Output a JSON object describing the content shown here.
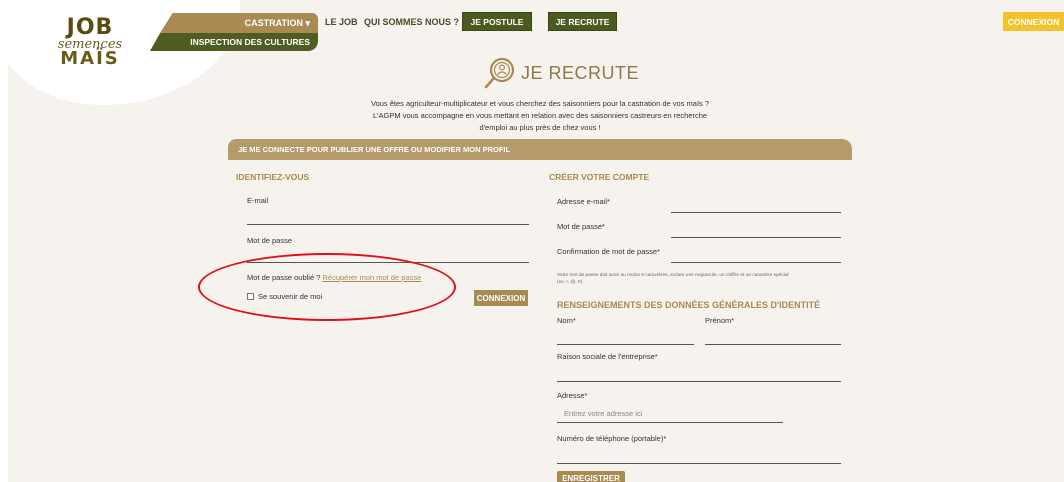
{
  "brand": {
    "line1": "JOB",
    "line2": "semences",
    "line3": "MAÏS"
  },
  "nav": {
    "castration": "CASTRATION ▾",
    "inspection": "INSPECTION DES CULTURES",
    "le_job": "LE JOB",
    "qui_sommes_nous": "QUI SOMMES NOUS ?",
    "je_postule": "JE POSTULE",
    "je_recrute": "JE RECRUTE",
    "connexion": "CONNEXION"
  },
  "page": {
    "title": "JE RECRUTE",
    "intro_l1": "Vous êtes agriculteur-multiplicateur et vous cherchez des saisonniers pour la castration de vos maïs ?",
    "intro_l2": "L'AGPM vous accompagne en vous mettant en relation avec des saisonniers castreurs en recherche",
    "intro_l3": "d'emploi au plus près de chez vous !",
    "band": "JE ME CONNECTE POUR PUBLIER UNE OFFRE OU MODIFIER MON PROFIL"
  },
  "login": {
    "title": "IDENTIFIEZ-VOUS",
    "email_label": "E-mail",
    "password_label": "Mot de passe",
    "forgot_text": "Mot de passe oublié ?",
    "forgot_link": "Récupérer mon mot de passe",
    "remember": "Se souvenir de moi",
    "submit": "CONNEXION"
  },
  "register": {
    "title": "CRÉER VOTRE COMPTE",
    "email_label": "Adresse e-mail*",
    "password_label": "Mot de passe*",
    "confirm_label": "Confirmation de mot de passe*",
    "help_l1": "Votre mot de passe doit avoir au moins 8 caractères, inclure une majuscule, un chiffre et un caractère spécial",
    "help_l2": "(ex. !, @, #).",
    "identity_title": "RENSEIGNEMENTS DES DONNÉES GÉNÉRALES D'IDENTITÉ",
    "nom_label": "Nom*",
    "prenom_label": "Prénom*",
    "raison_label": "Raison sociale de l'entreprise*",
    "adresse_label": "Adresse*",
    "adresse_placeholder": "Entrez votre adresse ici",
    "phone_label": "Numéro de téléphone (portable)*",
    "submit": "ENREGISTRER"
  },
  "colors": {
    "accent_brown": "#a88a52",
    "nav_green": "#4b5a1f",
    "connexion_yellow": "#f2c32a",
    "annotation_red": "#e0101a"
  }
}
